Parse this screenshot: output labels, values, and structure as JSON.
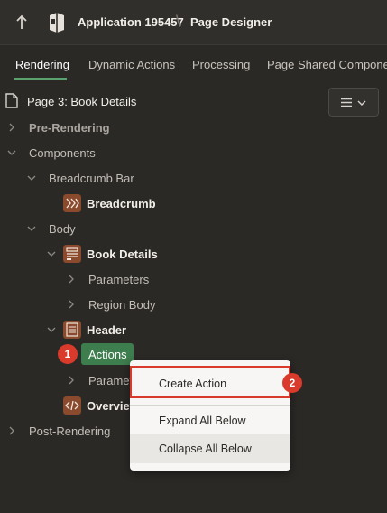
{
  "header": {
    "app_name": "Application 195457",
    "separator": "\\",
    "page_designer": "Page Designer"
  },
  "tabs": [
    {
      "label": "Rendering",
      "active": true
    },
    {
      "label": "Dynamic Actions",
      "active": false
    },
    {
      "label": "Processing",
      "active": false
    },
    {
      "label": "Page Shared Components",
      "active": false
    }
  ],
  "page": {
    "title": "Page 3: Book Details"
  },
  "tree": {
    "pre_rendering": "Pre-Rendering",
    "components": "Components",
    "breadcrumb_bar": "Breadcrumb Bar",
    "breadcrumb": "Breadcrumb",
    "body": "Body",
    "book_details": "Book Details",
    "parameters_1": "Parameters",
    "region_body": "Region Body",
    "header": "Header",
    "actions": "Actions",
    "parameters_2": "Parameters",
    "overview": "Overview",
    "post_rendering": "Post-Rendering"
  },
  "context_menu": {
    "create_action": "Create Action",
    "expand_all_below": "Expand All Below",
    "collapse_all_below": "Collapse All Below"
  },
  "markers": {
    "step1": "1",
    "step2": "2"
  },
  "colors": {
    "background": "#2b2926",
    "accent_green": "#3d7d4e",
    "marker_red": "#d93a2b",
    "icon_brown": "#8a4a2e"
  }
}
